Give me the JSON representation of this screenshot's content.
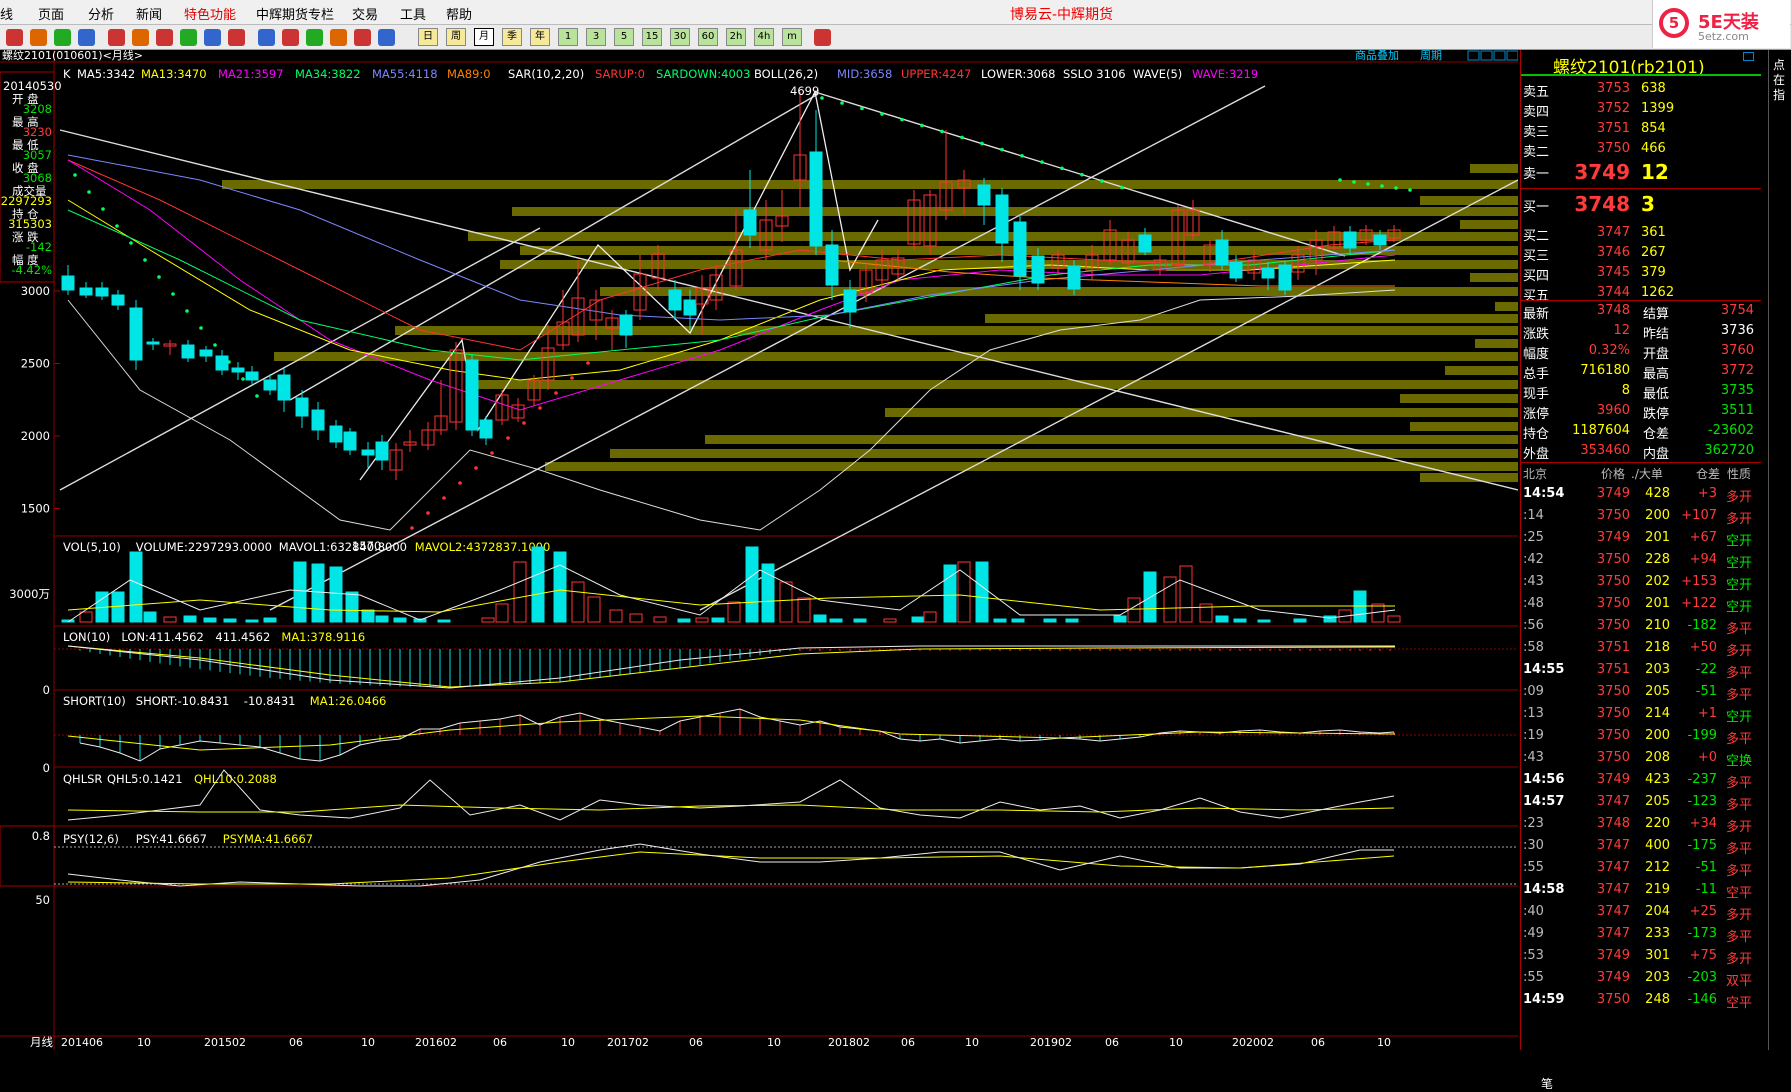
{
  "menu": [
    "线",
    "页面",
    "分析",
    "新闻",
    "特色功能",
    "中辉期货专栏",
    "交易",
    "工具",
    "帮助"
  ],
  "app_title": "博易云-中辉期货",
  "logo": {
    "mark": "5",
    "name": "5E天装",
    "site": "5etz.com"
  },
  "toolbar_labels": [
    "日",
    "周",
    "月",
    "季",
    "年",
    "1",
    "3",
    "5",
    "15",
    "30",
    "60",
    "2h",
    "4h",
    "m"
  ],
  "chart": {
    "tab_label": "螺纹2101(010601)<月线>",
    "links": [
      "商品叠加",
      "周期"
    ],
    "main_indicators": [
      {
        "text": "K",
        "color": "#ffffff"
      },
      {
        "text": "MA5:3342",
        "color": "#ffffff"
      },
      {
        "text": "MA13:3470",
        "color": "#ffff00"
      },
      {
        "text": "MA21:3597",
        "color": "#ff00ff"
      },
      {
        "text": "MA34:3822",
        "color": "#00ff66"
      },
      {
        "text": "MA55:4118",
        "color": "#7b86ff"
      },
      {
        "text": "MA89:0",
        "color": "#ff8000"
      },
      {
        "text": "SAR(10,2,20)",
        "color": "#ffffff"
      },
      {
        "text": "SARUP:0",
        "color": "#ff3333"
      },
      {
        "text": "SARDOWN:4003",
        "color": "#00ff66"
      },
      {
        "text": "BOLL(26,2)",
        "color": "#ffffff"
      },
      {
        "text": "MID:3658",
        "color": "#7b86ff"
      },
      {
        "text": "UPPER:4247",
        "color": "#ff3333"
      },
      {
        "text": "LOWER:3068",
        "color": "#ffffff"
      },
      {
        "text": "SSLO 3106",
        "color": "#ffffff"
      },
      {
        "text": "WAVE(5)",
        "color": "#ffffff"
      },
      {
        "text": "WAVE:3219",
        "color": "#ff00ff"
      }
    ],
    "y_labels": [
      "3000",
      "2500",
      "2000",
      "1500"
    ],
    "x_labels": [
      "201406",
      "10",
      "201502",
      "06",
      "10",
      "201602",
      "06",
      "10",
      "201702",
      "06",
      "10",
      "201802",
      "06",
      "10",
      "201902",
      "06",
      "10",
      "202002",
      "06",
      "10"
    ],
    "x_axis_title": "月线",
    "peak_label": "4699",
    "trough_label": "1570",
    "info_box": {
      "date": "20140530",
      "open_label": "开 盘",
      "open": "3208",
      "high_label": "最 高",
      "high": "3230",
      "low_label": "最 低",
      "low": "3057",
      "close_label": "收 盘",
      "close": "3068",
      "vol_label": "成交量",
      "vol": "2297293",
      "oi_label": "持 仓",
      "oi": "315303",
      "chg_label": "涨 跌",
      "chg": "-142",
      "pct_label": "幅 度",
      "pct": "-4.42%"
    },
    "vol": {
      "title": "VOL(5,10)",
      "t1": "VOLUME:2297293.0000",
      "t2": "MAVOL1:632840.8000",
      "t3": "MAVOL2:4372837.1000",
      "axis": "3000万"
    },
    "lon": {
      "title": "LON(10)",
      "t1": "LON:411.4562",
      "t2": "411.4562",
      "t3": "MA1:378.9116",
      "axis": "0"
    },
    "short": {
      "title": "SHORT(10)",
      "t1": "SHORT:-10.8431",
      "t2": "-10.8431",
      "t3": "MA1:26.0466",
      "axis": "0"
    },
    "qhlsr": {
      "title": "QHLSR",
      "t1": "QHL5:0.1421",
      "t2": "QHL10:0.2088",
      "axis": "0.8"
    },
    "psy": {
      "title": "PSY(12,6)",
      "t1": "PSY:41.6667",
      "t2": "PSYMA:41.6667",
      "axis": "50"
    }
  },
  "quote": {
    "title": "螺纹2101(rb2101)",
    "asks": [
      {
        "label": "卖五",
        "price": "3753",
        "vol": "638"
      },
      {
        "label": "卖四",
        "price": "3752",
        "vol": "1399"
      },
      {
        "label": "卖三",
        "price": "3751",
        "vol": "854"
      },
      {
        "label": "卖二",
        "price": "3750",
        "vol": "466"
      },
      {
        "label": "卖一",
        "price": "3749",
        "vol": "12"
      }
    ],
    "bids": [
      {
        "label": "买一",
        "price": "3748",
        "vol": "3"
      },
      {
        "label": "买二",
        "price": "3747",
        "vol": "361"
      },
      {
        "label": "买三",
        "price": "3746",
        "vol": "267"
      },
      {
        "label": "买四",
        "price": "3745",
        "vol": "379"
      },
      {
        "label": "买五",
        "price": "3744",
        "vol": "1262"
      }
    ],
    "stats": [
      {
        "l1": "最新",
        "v1": "3748",
        "c1": "red",
        "l2": "结算",
        "v2": "3754",
        "c2": "red"
      },
      {
        "l1": "涨跌",
        "v1": "12",
        "c1": "red",
        "l2": "昨结",
        "v2": "3736",
        "c2": "wht"
      },
      {
        "l1": "幅度",
        "v1": "0.32%",
        "c1": "red",
        "l2": "开盘",
        "v2": "3760",
        "c2": "red"
      },
      {
        "l1": "总手",
        "v1": "716180",
        "c1": "yel",
        "l2": "最高",
        "v2": "3772",
        "c2": "red"
      },
      {
        "l1": "现手",
        "v1": "8",
        "c1": "yel",
        "l2": "最低",
        "v2": "3735",
        "c2": "grn"
      },
      {
        "l1": "涨停",
        "v1": "3960",
        "c1": "red",
        "l2": "跌停",
        "v2": "3511",
        "c2": "grn"
      },
      {
        "l1": "持仓",
        "v1": "1187604",
        "c1": "yel",
        "l2": "仓差",
        "v2": "-23602",
        "c2": "grn"
      },
      {
        "l1": "外盘",
        "v1": "353460",
        "c1": "red",
        "l2": "内盘",
        "v2": "362720",
        "c2": "grn"
      }
    ],
    "tick_header": [
      "北京",
      "价格",
      "./大单",
      "仓差",
      "性质"
    ],
    "ticks": [
      {
        "t": "14:54",
        "p": "3749",
        "v": "428",
        "d": "+3",
        "k": "多开",
        "kc": "red",
        "b": true
      },
      {
        "t": ":14",
        "p": "3750",
        "v": "200",
        "d": "+107",
        "k": "多开",
        "kc": "red"
      },
      {
        "t": ":25",
        "p": "3749",
        "v": "201",
        "d": "+67",
        "k": "空开",
        "kc": "grn"
      },
      {
        "t": ":42",
        "p": "3750",
        "v": "228",
        "d": "+94",
        "k": "空开",
        "kc": "grn"
      },
      {
        "t": ":43",
        "p": "3750",
        "v": "202",
        "d": "+153",
        "k": "空开",
        "kc": "grn"
      },
      {
        "t": ":48",
        "p": "3750",
        "v": "201",
        "d": "+122",
        "k": "空开",
        "kc": "grn"
      },
      {
        "t": ":56",
        "p": "3750",
        "v": "210",
        "d": "-182",
        "k": "多平",
        "kc": "red"
      },
      {
        "t": ":58",
        "p": "3751",
        "v": "218",
        "d": "+50",
        "k": "多开",
        "kc": "red"
      },
      {
        "t": "14:55",
        "p": "3751",
        "v": "203",
        "d": "-22",
        "k": "多平",
        "kc": "red",
        "b": true
      },
      {
        "t": ":09",
        "p": "3750",
        "v": "205",
        "d": "-51",
        "k": "多平",
        "kc": "red"
      },
      {
        "t": ":13",
        "p": "3750",
        "v": "214",
        "d": "+1",
        "k": "空开",
        "kc": "grn"
      },
      {
        "t": ":19",
        "p": "3750",
        "v": "200",
        "d": "-199",
        "k": "多平",
        "kc": "red"
      },
      {
        "t": ":43",
        "p": "3750",
        "v": "208",
        "d": "+0",
        "k": "空换",
        "kc": "grn"
      },
      {
        "t": "14:56",
        "p": "3749",
        "v": "423",
        "d": "-237",
        "k": "多平",
        "kc": "red",
        "b": true
      },
      {
        "t": "14:57",
        "p": "3747",
        "v": "205",
        "d": "-123",
        "k": "多平",
        "kc": "red",
        "b": true
      },
      {
        "t": ":23",
        "p": "3748",
        "v": "220",
        "d": "+34",
        "k": "多开",
        "kc": "red"
      },
      {
        "t": ":30",
        "p": "3747",
        "v": "400",
        "d": "-175",
        "k": "多平",
        "kc": "red"
      },
      {
        "t": ":55",
        "p": "3747",
        "v": "212",
        "d": "-51",
        "k": "多平",
        "kc": "red"
      },
      {
        "t": "14:58",
        "p": "3747",
        "v": "219",
        "d": "-11",
        "k": "空平",
        "kc": "red",
        "b": true
      },
      {
        "t": ":40",
        "p": "3747",
        "v": "204",
        "d": "+25",
        "k": "多开",
        "kc": "red"
      },
      {
        "t": ":49",
        "p": "3747",
        "v": "233",
        "d": "-173",
        "k": "多平",
        "kc": "red"
      },
      {
        "t": ":53",
        "p": "3749",
        "v": "301",
        "d": "+75",
        "k": "多开",
        "kc": "red"
      },
      {
        "t": ":55",
        "p": "3749",
        "v": "203",
        "d": "-203",
        "k": "双平",
        "kc": "red"
      },
      {
        "t": "14:59",
        "p": "3750",
        "v": "248",
        "d": "-146",
        "k": "空平",
        "kc": "red",
        "b": true
      }
    ],
    "footer": "笔"
  },
  "side_tab": "点在指"
}
